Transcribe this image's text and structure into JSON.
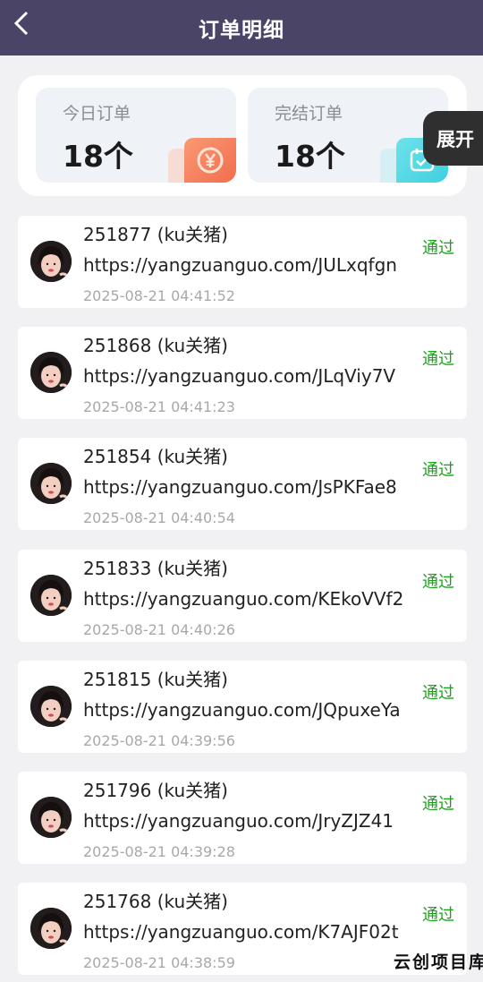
{
  "header": {
    "title": "订单明细",
    "back_icon": "chevron-left-icon"
  },
  "stats": {
    "today": {
      "label": "今日订单",
      "value": "18个",
      "icon": "yen-coin-icon",
      "color": "#f26d4e"
    },
    "done": {
      "label": "完结订单",
      "value": "18个",
      "icon": "calendar-check-icon",
      "color": "#3fcfe0"
    }
  },
  "expand_label": "展开",
  "orders": [
    {
      "title": "251877 (ku关猪)",
      "url": "https://yangzuanguo.com/JULxqfgn",
      "time": "2025-08-21 04:41:52",
      "status": "通过"
    },
    {
      "title": "251868 (ku关猪)",
      "url": "https://yangzuanguo.com/JLqViy7V",
      "time": "2025-08-21 04:41:23",
      "status": "通过"
    },
    {
      "title": "251854 (ku关猪)",
      "url": "https://yangzuanguo.com/JsPKFae8",
      "time": "2025-08-21 04:40:54",
      "status": "通过"
    },
    {
      "title": "251833 (ku关猪)",
      "url": "https://yangzuanguo.com/KEkoVVf2",
      "time": "2025-08-21 04:40:26",
      "status": "通过"
    },
    {
      "title": "251815 (ku关猪)",
      "url": "https://yangzuanguo.com/JQpuxeYa",
      "time": "2025-08-21 04:39:56",
      "status": "通过"
    },
    {
      "title": "251796 (ku关猪)",
      "url": "https://yangzuanguo.com/JryZJZ41",
      "time": "2025-08-21 04:39:28",
      "status": "通过"
    },
    {
      "title": "251768 (ku关猪)",
      "url": "https://yangzuanguo.com/K7AJF02t",
      "time": "2025-08-21 04:38:59",
      "status": "通过"
    }
  ],
  "watermark": "云创项目库",
  "colors": {
    "header_bg": "#4a4466",
    "status_green": "#1aa31a",
    "page_bg": "#f1f1f3"
  }
}
